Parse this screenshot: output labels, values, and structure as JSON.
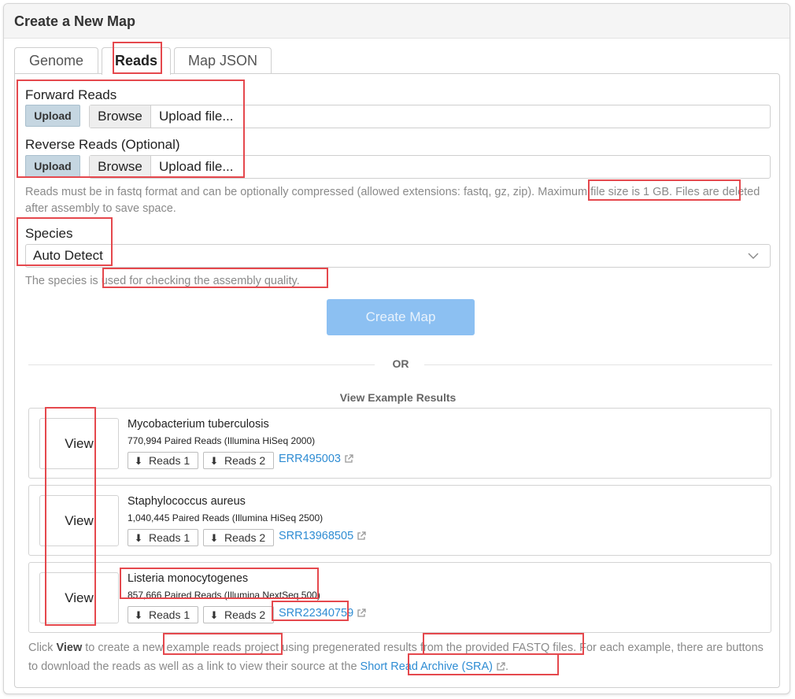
{
  "header": {
    "title": "Create a New Map"
  },
  "tabs": [
    {
      "label": "Genome"
    },
    {
      "label": "Reads"
    },
    {
      "label": "Map JSON"
    }
  ],
  "forward": {
    "label": "Forward Reads",
    "upload": "Upload",
    "browse": "Browse",
    "placeholder": "Upload file..."
  },
  "reverse": {
    "label": "Reverse Reads (Optional)",
    "upload": "Upload",
    "browse": "Browse",
    "placeholder": "Upload file..."
  },
  "reads_help": {
    "part1": "Reads must be in fastq format and can be optionally compressed (allowed extensions: fastq, gz, zip). ",
    "part2": "Maximum file size is 1 GB.",
    "part3": " Files are deleted after assembly to save space."
  },
  "species": {
    "label": "Species",
    "selected": "Auto Detect",
    "help_prefix": "The species is ",
    "help_highlight": "used for checking the assembly quality."
  },
  "create_button": "Create Map",
  "or_label": "OR",
  "examples_title": "View Example Results",
  "examples": [
    {
      "view": "View",
      "name": "Mycobacterium tuberculosis",
      "meta": "770,994 Paired Reads (Illumina HiSeq 2000)",
      "reads1": "Reads 1",
      "reads2": "Reads 2",
      "accession": "ERR495003"
    },
    {
      "view": "View",
      "name": "Staphylococcus aureus",
      "meta": "1,040,445 Paired Reads (Illumina HiSeq 2500)",
      "reads1": "Reads 1",
      "reads2": "Reads 2",
      "accession": "SRR13968505"
    },
    {
      "view": "View",
      "name": "Listeria monocytogenes",
      "meta": "857,666 Paired Reads (Illumina NextSeq 500)",
      "reads1": "Reads 1",
      "reads2": "Reads 2",
      "accession": "SRR22340759"
    }
  ],
  "footer": {
    "t1": "Click ",
    "view_bold": "View",
    "t2": " to create a new ",
    "t3": "example reads project",
    "t4": " using pregenerated results ",
    "t5": "from the provided FASTQ files",
    "t6": ". For each example, there are buttons to download the reads as well as a link to view their source at the ",
    "link": "Short Read Archive (SRA)",
    "t7": "."
  },
  "colors": {
    "accent": "#2e8cd3",
    "highlight": "#e5484d",
    "primary_disabled": "#8cc0f2",
    "upload_bg": "#c5d6e1"
  },
  "icons": [
    "download-arrow-icon",
    "external-link-icon",
    "chevron-down-icon"
  ]
}
